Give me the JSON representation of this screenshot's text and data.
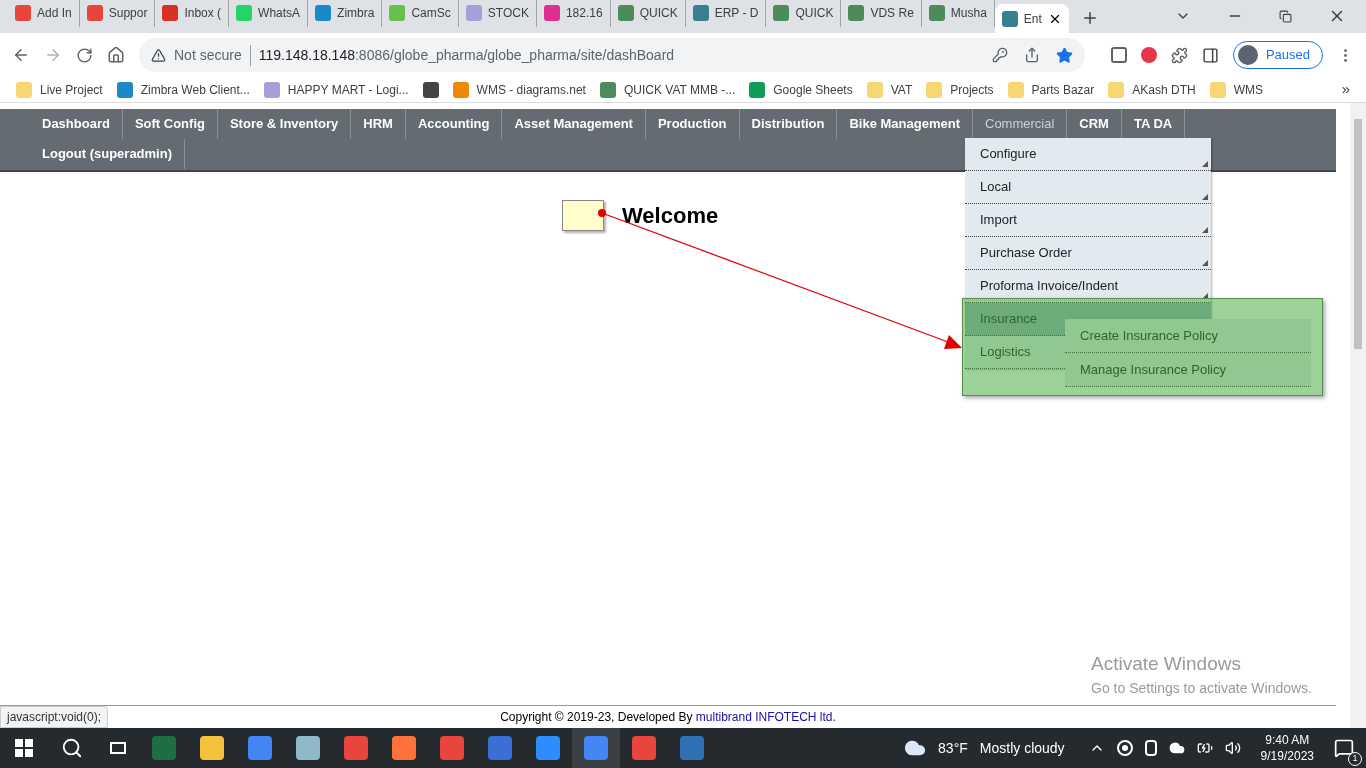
{
  "browser": {
    "tabs": [
      {
        "title": "Add In",
        "selected": false,
        "color": "#e8453c"
      },
      {
        "title": "Suppor",
        "selected": false,
        "color": "#e8453c"
      },
      {
        "title": "Inbox (",
        "selected": false,
        "color": "#d93025"
      },
      {
        "title": "WhatsA",
        "selected": false,
        "color": "#25d366"
      },
      {
        "title": "Zimbra",
        "selected": false,
        "color": "#1a88c9"
      },
      {
        "title": "CamSc",
        "selected": false,
        "color": "#6abf4b"
      },
      {
        "title": "STOCK",
        "selected": false,
        "color": "#a79fd8"
      },
      {
        "title": "182.16",
        "selected": false,
        "color": "#e0308f"
      },
      {
        "title": "QUICK",
        "selected": false,
        "color": "#4e8a5a"
      },
      {
        "title": "ERP - D",
        "selected": false,
        "color": "#3a7f8f"
      },
      {
        "title": "QUICK",
        "selected": false,
        "color": "#4e8a5a"
      },
      {
        "title": "VDS Re",
        "selected": false,
        "color": "#4e8a5a"
      },
      {
        "title": "Musha",
        "selected": false,
        "color": "#4e8a5a"
      },
      {
        "title": "Ent",
        "selected": true,
        "color": "#3a7f8f"
      }
    ],
    "security": "Not secure",
    "url_host": "119.148.18.148",
    "url_rest": ":8086/globe_pharma/globe_pharma/site/dashBoard",
    "profile": "Paused",
    "bookmarks": [
      {
        "title": "Live Project",
        "color": "#f7d774"
      },
      {
        "title": "Zimbra Web Client...",
        "color": "#1a88c9"
      },
      {
        "title": "HAPPY MART - Logi...",
        "color": "#a79fd8"
      },
      {
        "color": "#444444"
      },
      {
        "title": "WMS - diagrams.net",
        "color": "#f08705"
      },
      {
        "title": "QUICK VAT MMB -...",
        "color": "#4e8a5a"
      },
      {
        "title": "Google Sheets",
        "color": "#0f9d58"
      },
      {
        "title": "VAT",
        "color": "#f7d774"
      },
      {
        "title": "Projects",
        "color": "#f7d774"
      },
      {
        "title": "Parts Bazar",
        "color": "#f7d774"
      },
      {
        "title": "AKash DTH",
        "color": "#f7d774"
      },
      {
        "title": "WMS",
        "color": "#f7d774"
      }
    ],
    "more": "»"
  },
  "nav": {
    "items": [
      {
        "label": "Dashboard",
        "selected": false
      },
      {
        "label": "Soft Config",
        "selected": false
      },
      {
        "label": "Store & Inventory",
        "selected": false
      },
      {
        "label": "HRM",
        "selected": false
      },
      {
        "label": "Accounting",
        "selected": false
      },
      {
        "label": "Asset Management",
        "selected": false
      },
      {
        "label": "Production",
        "selected": false
      },
      {
        "label": "Distribution",
        "selected": false
      },
      {
        "label": "Bike Management",
        "selected": false
      },
      {
        "label": "Commercial",
        "selected": true
      },
      {
        "label": "CRM",
        "selected": false
      },
      {
        "label": "TA DA",
        "selected": false
      },
      {
        "label": "Logout (superadmin)",
        "selected": false
      }
    ],
    "dropdown": [
      {
        "label": "Configure",
        "expanded": false
      },
      {
        "label": "Local",
        "expanded": false
      },
      {
        "label": "Import",
        "expanded": false
      },
      {
        "label": "Purchase Order",
        "expanded": false
      },
      {
        "label": "Proforma Invoice/Indent",
        "expanded": false
      },
      {
        "label": "Insurance",
        "expanded": true
      },
      {
        "label": "Logistics",
        "expanded": false
      }
    ],
    "submenu": [
      "Create Insurance Policy",
      "Manage Insurance Policy"
    ]
  },
  "welcome": "Welcome",
  "watermark": {
    "title": "Activate Windows",
    "text": "Go to Settings to activate Windows."
  },
  "footer": {
    "text": "Copyright © 2019-23, Developed By",
    "link": "multibrand INFOTECH ltd."
  },
  "status_url": "javascript:void(0);",
  "taskbar": {
    "temperature": "83°F",
    "weather": "Mostly cloudy",
    "time": "9:40 AM",
    "date": "9/19/2023",
    "notifications": "1"
  }
}
